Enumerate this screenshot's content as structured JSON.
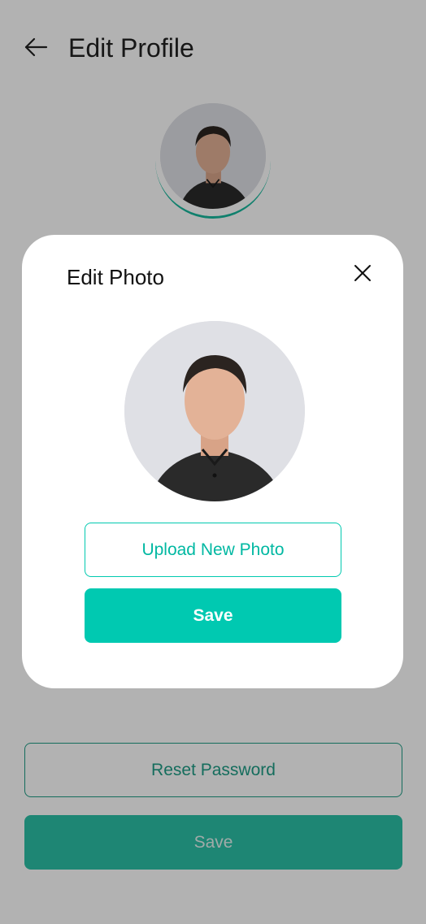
{
  "header": {
    "title": "Edit Profile",
    "back_icon": "arrow-left-icon"
  },
  "profile": {
    "avatar_icon": "profile-photo"
  },
  "actions": {
    "reset_password_label": "Reset Password",
    "save_label": "Save"
  },
  "modal": {
    "title": "Edit Photo",
    "close_icon": "close-icon",
    "upload_label": "Upload New Photo",
    "save_label": "Save"
  },
  "colors": {
    "accent": "#00c9b1",
    "accent_dark": "#1f9d86",
    "overlay": "#000000"
  }
}
